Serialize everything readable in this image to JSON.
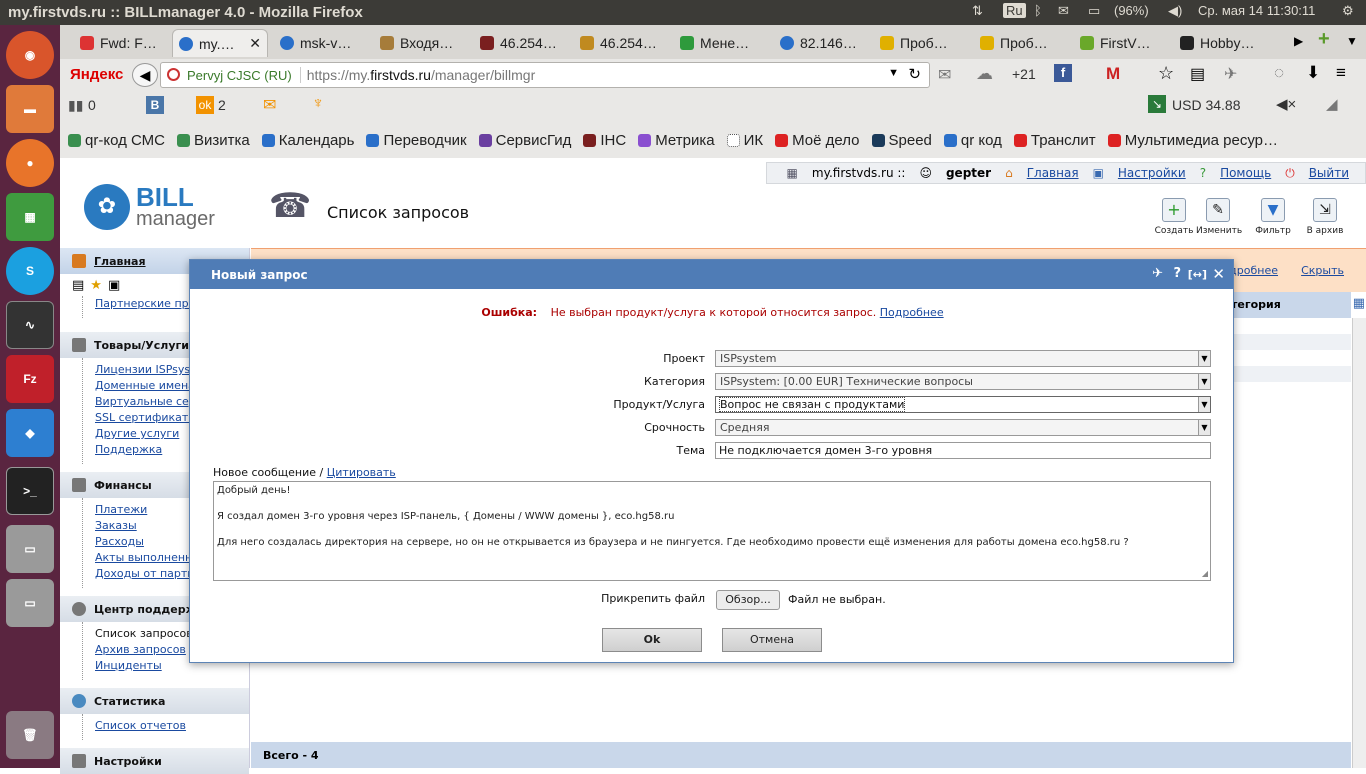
{
  "os": {
    "window_title": "my.firstvds.ru :: BILLmanager 4.0 - Mozilla Firefox",
    "keyboard_layout": "Ru",
    "battery": "(96%)",
    "clock": "Ср. мая 14 11:30:11"
  },
  "browser": {
    "tabs": [
      {
        "label": "Fwd: F…",
        "color": "#d33"
      },
      {
        "label": "my.…",
        "color": "#2a6fc9"
      },
      {
        "label": "msk-v…",
        "color": "#2a6fc9"
      },
      {
        "label": "Входя…",
        "color": "#a67c3a"
      },
      {
        "label": "46.254…",
        "color": "#7a1f1f"
      },
      {
        "label": "46.254…",
        "color": "#c08a20"
      },
      {
        "label": "Мене…",
        "color": "#2e9a3c"
      },
      {
        "label": "82.146…",
        "color": "#2a6fc9"
      },
      {
        "label": "Проб…",
        "color": "#e0b000"
      },
      {
        "label": "Проб…",
        "color": "#e0b000"
      },
      {
        "label": "FirstV…",
        "color": "#6aa82a"
      },
      {
        "label": "Hobby…",
        "color": "#222"
      }
    ],
    "yandex_label": "Яндекс",
    "identity": "Pervyj CJSC (RU)",
    "url_prefix": "https://my.",
    "url_domain": "firstvds.ru",
    "url_path": "/manager/billmgr",
    "weather": "+21",
    "addon_counts": {
      "mail": "0",
      "odnoklassniki": "2"
    },
    "currency": "USD 34.88",
    "bookmarks": [
      {
        "label": "qr-код СМС",
        "color": "#3a8f4f"
      },
      {
        "label": "Визитка",
        "color": "#3a8f4f"
      },
      {
        "label": "Календарь",
        "color": "#2a6fc9"
      },
      {
        "label": "Переводчик",
        "color": "#2a6fc9"
      },
      {
        "label": "СервисГид",
        "color": "#6a3fa0"
      },
      {
        "label": "IHC",
        "color": "#7a1f1f"
      },
      {
        "label": "Метрика",
        "color": "#8a4fd0"
      },
      {
        "label": "ИК",
        "color": "#ffffff"
      },
      {
        "label": "Моё дело",
        "color": "#d22"
      },
      {
        "label": "Speed",
        "color": "#1a3a5a"
      },
      {
        "label": "qr код",
        "color": "#2a6fc9"
      },
      {
        "label": "Транслит",
        "color": "#d22"
      },
      {
        "label": "Мультимедиа ресур…",
        "color": "#d22"
      }
    ]
  },
  "billmanager": {
    "logo_top": "BILL",
    "logo_bottom": "manager",
    "page_title": "Список запросов",
    "userbar": {
      "site": "my.firstvds.ru ::",
      "user": "gepter",
      "links": [
        "Главная",
        "Настройки",
        "Помощь",
        "Выйти"
      ]
    },
    "toolbar": [
      "Создать",
      "Изменить",
      "Фильтр",
      "В архив"
    ],
    "error_strip_links": [
      "Подробнее",
      "Скрыть"
    ],
    "col_header_right": "тегория",
    "footer_total": "Всего - 4",
    "sidebar": [
      {
        "title": "Главная",
        "items": [
          "Партнерские прогр"
        ]
      },
      {
        "title": "Товары/Услуги",
        "items": [
          "Лицензии ISPsyste",
          "Доменные имена",
          "Виртуальные серв",
          "SSL сертификаты",
          "Другие услуги",
          "Поддержка"
        ]
      },
      {
        "title": "Финансы",
        "items": [
          "Платежи",
          "Заказы",
          "Расходы",
          "Акты выполненн",
          "Доходы от партнер"
        ]
      },
      {
        "title": "Центр поддержк",
        "items": [
          "Список запросов",
          "Архив запросов",
          "Инциденты"
        ]
      },
      {
        "title": "Статистика",
        "items": [
          "Список отчетов"
        ]
      },
      {
        "title": "Настройки",
        "items": []
      }
    ]
  },
  "dialog": {
    "title": "Новый запрос",
    "error_label": "Ошибка:",
    "error_text": "Не выбран продукт/услуга к которой относится запрос.",
    "error_link": "Подробнее",
    "fields": [
      {
        "label": "Проект",
        "value": "ISPsystem",
        "type": "select"
      },
      {
        "label": "Категория",
        "value": "ISPsystem: [0.00 EUR] Технические вопросы",
        "type": "select"
      },
      {
        "label": "Продукт/Услуга",
        "value": "Вопрос не связан с продуктами",
        "type": "select"
      },
      {
        "label": "Срочность",
        "value": "Средняя",
        "type": "select"
      },
      {
        "label": "Тема",
        "value": "Не подключается домен 3-го уровня",
        "type": "text"
      }
    ],
    "message_label": "Новое сообщение /",
    "quote_link": "Цитировать",
    "message_lines": [
      "Добрый день!",
      "Я создал домен 3-го уровня через ISP-панель, { Домены / WWW домены }, eco.hg58.ru",
      "Для него создалась директория на сервере, но он не открывается из браузера и не пингуется. Где необходимо провести ещё изменения для работы домена eco.hg58.ru ?"
    ],
    "attach_label": "Прикрепить файл",
    "browse_label": "Обзор...",
    "no_file": "Файл не выбран.",
    "ok_label": "Ok",
    "cancel_label": "Отмена"
  }
}
